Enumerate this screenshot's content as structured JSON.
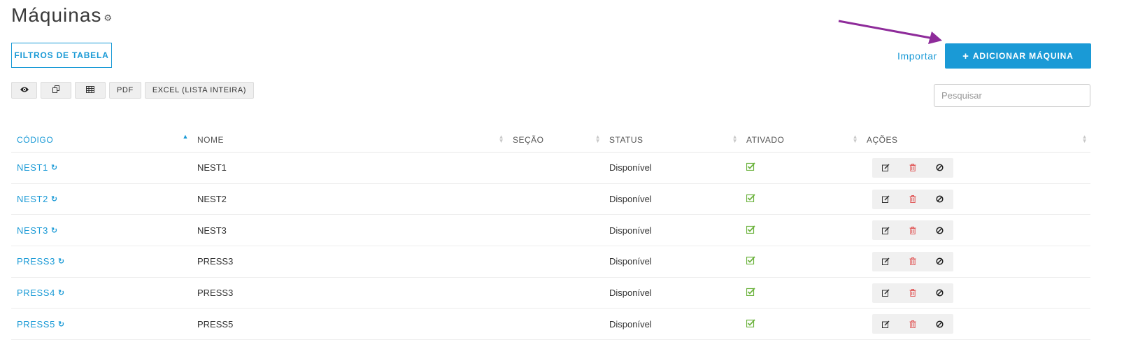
{
  "header": {
    "title": "Máquinas",
    "gear_icon": "gear-icon"
  },
  "filters": {
    "label": "FILTROS DE TABELA"
  },
  "actions_bar": {
    "import_label": "Importar",
    "add_label": "ADICIONAR MÁQUINA",
    "add_icon": "+"
  },
  "toolbar": {
    "view_icon": "eye-icon",
    "copy_icon": "copy-icon",
    "csv_icon": "table-icon",
    "pdf_label": "PDF",
    "excel_label": "EXCEL (LISTA INTEIRA)"
  },
  "search": {
    "placeholder": "Pesquisar"
  },
  "table": {
    "columns": [
      "CÓDIGO",
      "NOME",
      "SEÇÃO",
      "STATUS",
      "ATIVADO",
      "AÇÕES"
    ],
    "rows": [
      {
        "code": "NEST1",
        "nome": "NEST1",
        "secao": "",
        "status": "Disponível"
      },
      {
        "code": "NEST2",
        "nome": "NEST2",
        "secao": "",
        "status": "Disponível"
      },
      {
        "code": "NEST3",
        "nome": "NEST3",
        "secao": "",
        "status": "Disponível"
      },
      {
        "code": "PRESS3",
        "nome": "PRESS3",
        "secao": "",
        "status": "Disponível"
      },
      {
        "code": "PRESS4",
        "nome": "PRESS3",
        "secao": "",
        "status": "Disponível"
      },
      {
        "code": "PRESS5",
        "nome": "PRESS5",
        "secao": "",
        "status": "Disponível"
      }
    ]
  },
  "colors": {
    "accent": "#1a9ad6",
    "annotation": "#8e2b9a",
    "check": "#6db33f",
    "delete": "#e05a5a"
  }
}
